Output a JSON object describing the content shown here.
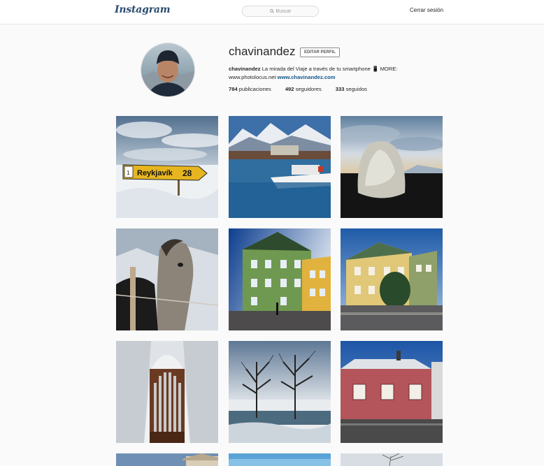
{
  "header": {
    "logo": "Instagram",
    "search_placeholder": "Buscar",
    "logout": "Cerrar sesión"
  },
  "profile": {
    "username": "chavinandez",
    "edit_button": "EDITAR PERFIL",
    "bio_name": "chavinandez",
    "bio_text": " La mirada del Viaje a través de tu smartphone 📱 MORE:",
    "bio_line2": "www.photolocus.net ",
    "bio_link": "www.chavinandez.com",
    "stats": {
      "posts_count": "784",
      "posts_label": "publicaciones",
      "followers_count": "492",
      "followers_label": "seguidores",
      "following_count": "333",
      "following_label": "seguidos"
    }
  },
  "posts": [
    {
      "name": "post-reykjavik-sign",
      "sign_text": "Reykjavík",
      "sign_num": "28",
      "sign_route": "1"
    },
    {
      "name": "post-harbor-mountains"
    },
    {
      "name": "post-ice-block"
    },
    {
      "name": "post-horse"
    },
    {
      "name": "post-green-building"
    },
    {
      "name": "post-yellow-house"
    },
    {
      "name": "post-church-organ"
    },
    {
      "name": "post-winter-trees"
    },
    {
      "name": "post-red-house"
    },
    {
      "name": "post-partial-1"
    },
    {
      "name": "post-partial-2"
    },
    {
      "name": "post-partial-3"
    }
  ]
}
